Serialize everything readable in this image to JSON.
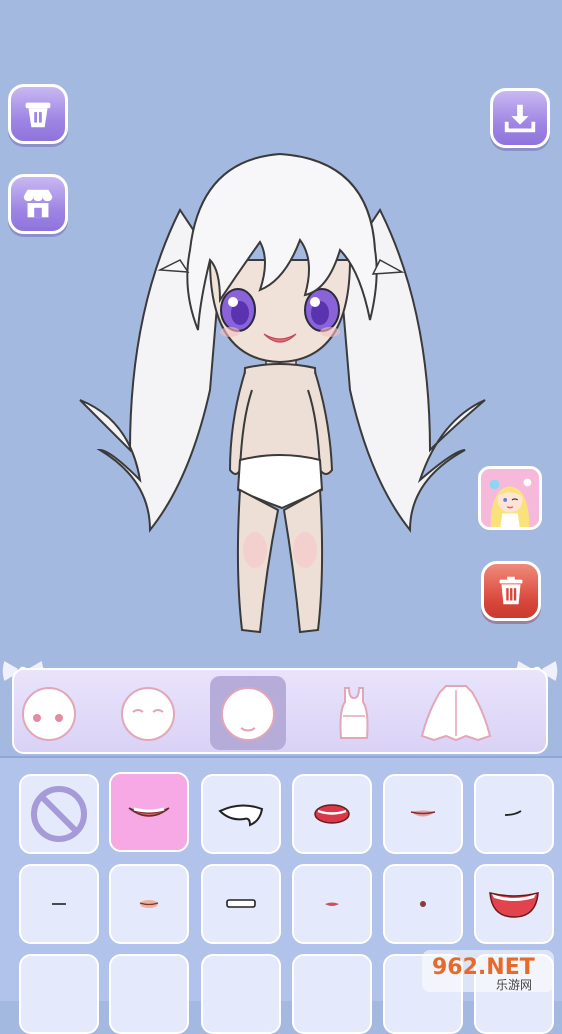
{
  "toolbar": {
    "reset_icon": "bucket-icon",
    "shop_icon": "shop-icon",
    "download_icon": "download-icon",
    "delete_icon": "trash-icon"
  },
  "tabs": [
    {
      "name": "face",
      "icon": "face-icon",
      "active": false
    },
    {
      "name": "face-blush",
      "icon": "face-blush-icon",
      "active": false
    },
    {
      "name": "mouth",
      "icon": "mouth-face-icon",
      "active": true
    },
    {
      "name": "top",
      "icon": "tank-top-icon",
      "active": false
    },
    {
      "name": "outerwear",
      "icon": "cape-icon",
      "active": false
    }
  ],
  "mouth_options": [
    {
      "icon": "none-icon",
      "selected": false
    },
    {
      "icon": "mouth-smile-teeth-icon",
      "selected": true
    },
    {
      "icon": "mouth-open-white-icon",
      "selected": false
    },
    {
      "icon": "mouth-open-red-icon",
      "selected": false
    },
    {
      "icon": "mouth-small-lips-icon",
      "selected": false
    },
    {
      "icon": "mouth-smirk-icon",
      "selected": false
    },
    {
      "icon": "mouth-line-icon",
      "selected": false
    },
    {
      "icon": "mouth-tiny-lips-icon",
      "selected": false
    },
    {
      "icon": "mouth-flat-teeth-icon",
      "selected": false
    },
    {
      "icon": "mouth-tiny-red-icon",
      "selected": false
    },
    {
      "icon": "mouth-dot-icon",
      "selected": false
    },
    {
      "icon": "mouth-big-grin-icon",
      "selected": false
    }
  ],
  "watermark": {
    "text": "962.NET",
    "sub": "乐游网"
  },
  "colors": {
    "background": "#a4b9e0",
    "accent": "#9f86e4",
    "selected": "#f6a9e4",
    "danger": "#d8463a"
  }
}
